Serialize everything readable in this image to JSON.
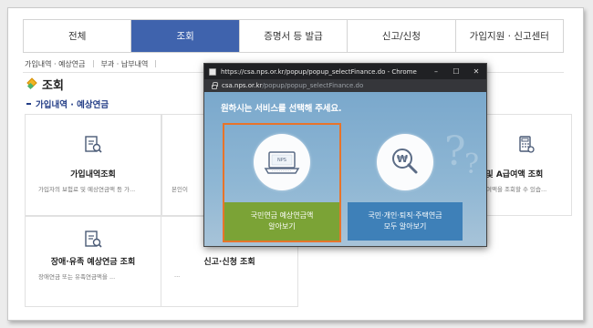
{
  "nav": {
    "tabs": [
      "전체",
      "조회",
      "증명서 등 발급",
      "신고/신청",
      "가입지원 · 신고센터"
    ],
    "active_index": 1
  },
  "subnav": {
    "items": [
      "가입내역 · 예상연금",
      "부과 · 납부내역",
      "",
      ""
    ]
  },
  "page": {
    "title": "조회",
    "section": "가입내역 · 예상연금"
  },
  "cards": [
    {
      "title": "가입내역조회",
      "desc": "가입자의 보험료 및 예상연금액 등 가...",
      "icon": "document-search-icon"
    },
    {
      "title": "",
      "desc": "본인이 ",
      "icon": "document-search-icon"
    },
    {
      "title": "록 및 A급여액 조회",
      "desc": "급여액을 조회할 수 있습...",
      "icon": "calculator-icon"
    },
    {
      "title": "장애·유족 예상연금 조회",
      "desc": "장애연금 또는 유족연금액을 ...",
      "icon": "document-search-icon"
    },
    {
      "title": "신고·신청 조회",
      "desc": "...",
      "icon": ""
    }
  ],
  "popup": {
    "window_title": "https://csa.nps.or.kr/popup/popup_selectFinance.do - Chrome",
    "url_host": "csa.nps.or.kr",
    "url_path": "/popup/popup_selectFinance.do",
    "heading": "원하시는 서비스를 선택해 주세요.",
    "options": [
      {
        "line1": "국민연금 예상연금액",
        "line2": "알아보기",
        "icon": "laptop-nps-icon",
        "color": "#7ba336",
        "selected": true
      },
      {
        "line1": "국민·개인·퇴직·주택연금",
        "line2": "모두 알아보기",
        "icon": "won-magnifier-icon",
        "color": "#3e80b8",
        "selected": false
      }
    ],
    "controls": {
      "minimize": "–",
      "maximize": "☐",
      "close": "✕"
    }
  },
  "colors": {
    "nav_active": "#3f63ad",
    "section_title": "#233d86",
    "selection_outline": "#e8742a"
  }
}
